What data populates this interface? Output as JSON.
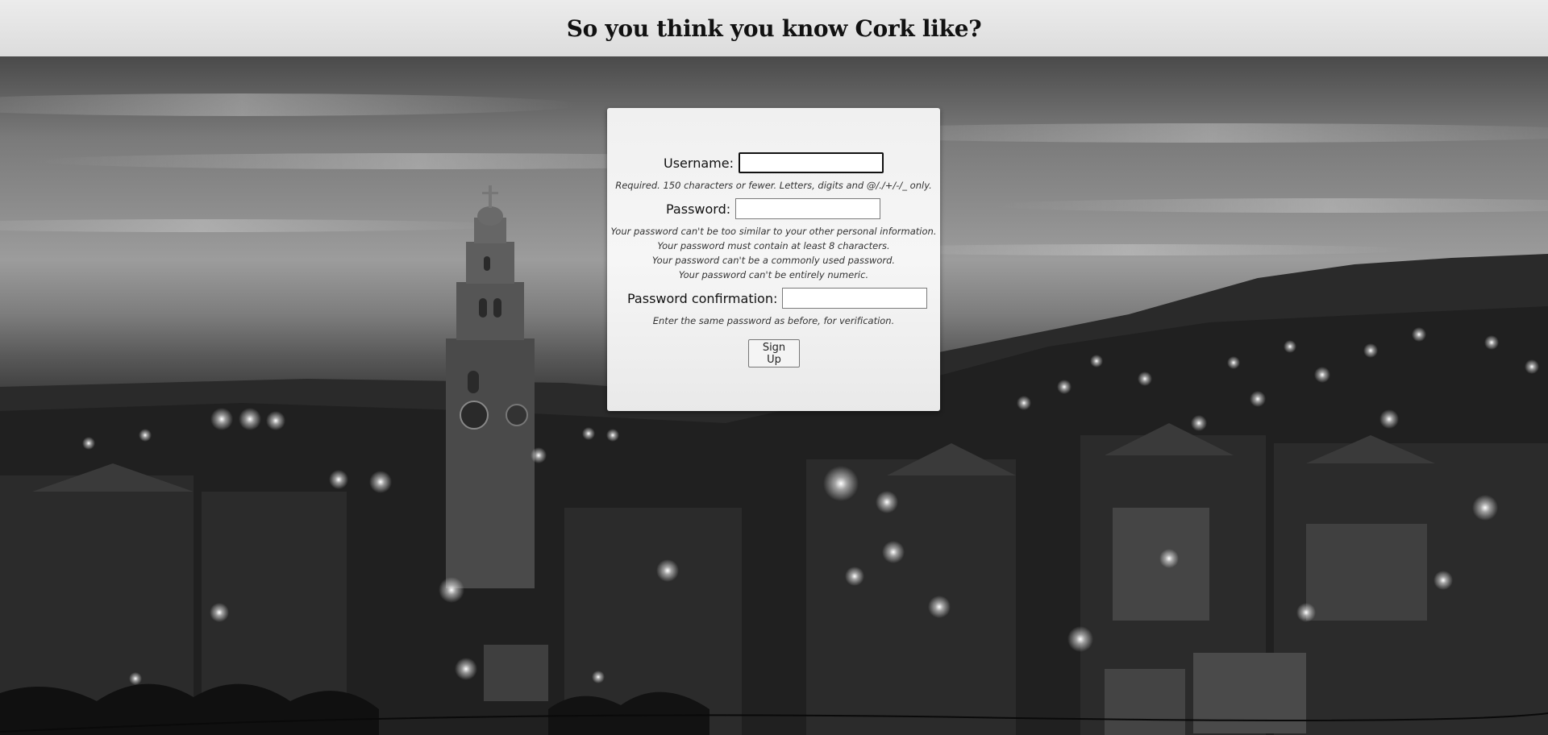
{
  "header": {
    "title": "So you think you know Cork like?"
  },
  "form": {
    "username": {
      "label": "Username:",
      "value": "",
      "help": "Required. 150 characters or fewer. Letters, digits and @/./+/-/_ only."
    },
    "password": {
      "label": "Password:",
      "value": "",
      "help": [
        "Your password can't be too similar to your other personal information.",
        "Your password must contain at least 8 characters.",
        "Your password can't be a commonly used password.",
        "Your password can't be entirely numeric."
      ]
    },
    "password_confirmation": {
      "label": "Password confirmation:",
      "value": "",
      "help": "Enter the same password as before, for verification."
    },
    "submit_label": "Sign Up"
  },
  "colors": {
    "header_bg": "#e4e4e4",
    "card_bg": "#f3f3f3",
    "text": "#111111"
  }
}
